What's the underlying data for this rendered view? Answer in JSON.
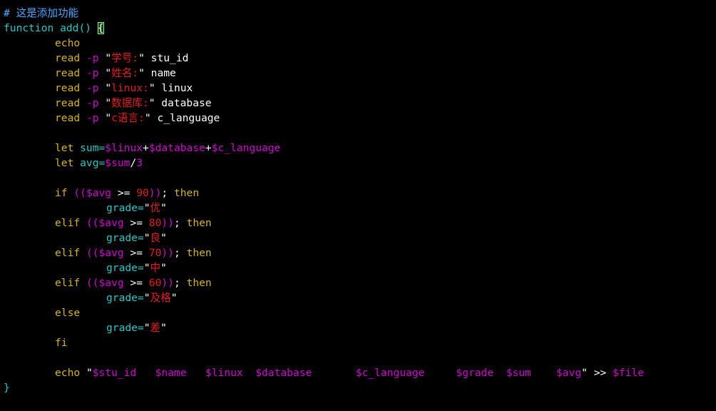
{
  "colors": {
    "background": "#000000",
    "plain": "#ffffff",
    "comment": "#4aa7ff",
    "keyword_cyan": "#27c7c7",
    "keyword": "#d7b600",
    "string": "#e31b1b",
    "variable": "#d000d0",
    "number": "#e31b1b",
    "cursor": "#7dff7d"
  },
  "lines": [
    [
      [
        "# 这是添加功能",
        "comment"
      ]
    ],
    [
      [
        "function",
        "keyword_cyan"
      ],
      [
        " add() ",
        "keyword_cyan"
      ],
      [
        "{",
        "cursor"
      ]
    ],
    [
      [
        "indent",
        "indent"
      ],
      [
        "echo",
        "keyword"
      ]
    ],
    [
      [
        "indent",
        "indent"
      ],
      [
        "read",
        "keyword"
      ],
      [
        " -p ",
        "variable"
      ],
      [
        "\"",
        "plain_str"
      ],
      [
        "学号:",
        "string"
      ],
      [
        "\"",
        "plain_str"
      ],
      [
        " stu_id",
        "plain"
      ]
    ],
    [
      [
        "indent",
        "indent"
      ],
      [
        "read",
        "keyword"
      ],
      [
        " -p ",
        "variable"
      ],
      [
        "\"",
        "plain_str"
      ],
      [
        "姓名:",
        "string"
      ],
      [
        "\"",
        "plain_str"
      ],
      [
        " name",
        "plain"
      ]
    ],
    [
      [
        "indent",
        "indent"
      ],
      [
        "read",
        "keyword"
      ],
      [
        " -p ",
        "variable"
      ],
      [
        "\"",
        "plain_str"
      ],
      [
        "linux:",
        "string"
      ],
      [
        "\"",
        "plain_str"
      ],
      [
        " linux",
        "plain"
      ]
    ],
    [
      [
        "indent",
        "indent"
      ],
      [
        "read",
        "keyword"
      ],
      [
        " -p ",
        "variable"
      ],
      [
        "\"",
        "plain_str"
      ],
      [
        "数据库:",
        "string"
      ],
      [
        "\"",
        "plain_str"
      ],
      [
        " database",
        "plain"
      ]
    ],
    [
      [
        "indent",
        "indent"
      ],
      [
        "read",
        "keyword"
      ],
      [
        " -p ",
        "variable"
      ],
      [
        "\"",
        "plain_str"
      ],
      [
        "c语言:",
        "string"
      ],
      [
        "\"",
        "plain_str"
      ],
      [
        " c_language",
        "plain"
      ]
    ],
    [],
    [
      [
        "indent",
        "indent"
      ],
      [
        "let",
        "keyword"
      ],
      [
        " sum=",
        "keyword_cyan"
      ],
      [
        "$linux",
        "variable"
      ],
      [
        "+",
        "plain"
      ],
      [
        "$database",
        "variable"
      ],
      [
        "+",
        "plain"
      ],
      [
        "$c_language",
        "variable"
      ]
    ],
    [
      [
        "indent",
        "indent"
      ],
      [
        "let",
        "keyword"
      ],
      [
        " avg=",
        "keyword_cyan"
      ],
      [
        "$sum",
        "variable"
      ],
      [
        "/",
        "plain"
      ],
      [
        "3",
        "variable"
      ]
    ],
    [],
    [
      [
        "indent",
        "indent"
      ],
      [
        "if",
        "keyword"
      ],
      [
        " ((",
        "variable"
      ],
      [
        "$avg",
        "variable"
      ],
      [
        " >= ",
        "plain"
      ],
      [
        "90",
        "number"
      ],
      [
        "))",
        "variable"
      ],
      [
        "; ",
        "plain"
      ],
      [
        "then",
        "keyword"
      ]
    ],
    [
      [
        "indent2",
        "indent2"
      ],
      [
        "grade=",
        "keyword_cyan"
      ],
      [
        "\"",
        "plain_str"
      ],
      [
        "优",
        "string"
      ],
      [
        "\"",
        "plain_str"
      ]
    ],
    [
      [
        "indent",
        "indent"
      ],
      [
        "elif",
        "keyword"
      ],
      [
        " ((",
        "variable"
      ],
      [
        "$avg",
        "variable"
      ],
      [
        " >= ",
        "plain"
      ],
      [
        "80",
        "number"
      ],
      [
        "))",
        "variable"
      ],
      [
        "; ",
        "plain"
      ],
      [
        "then",
        "keyword"
      ]
    ],
    [
      [
        "indent2",
        "indent2"
      ],
      [
        "grade=",
        "keyword_cyan"
      ],
      [
        "\"",
        "plain_str"
      ],
      [
        "良",
        "string"
      ],
      [
        "\"",
        "plain_str"
      ]
    ],
    [
      [
        "indent",
        "indent"
      ],
      [
        "elif",
        "keyword"
      ],
      [
        " ((",
        "variable"
      ],
      [
        "$avg",
        "variable"
      ],
      [
        " >= ",
        "plain"
      ],
      [
        "70",
        "number"
      ],
      [
        "))",
        "variable"
      ],
      [
        "; ",
        "plain"
      ],
      [
        "then",
        "keyword"
      ]
    ],
    [
      [
        "indent2",
        "indent2"
      ],
      [
        "grade=",
        "keyword_cyan"
      ],
      [
        "\"",
        "plain_str"
      ],
      [
        "中",
        "string"
      ],
      [
        "\"",
        "plain_str"
      ]
    ],
    [
      [
        "indent",
        "indent"
      ],
      [
        "elif",
        "keyword"
      ],
      [
        " ((",
        "variable"
      ],
      [
        "$avg",
        "variable"
      ],
      [
        " >= ",
        "plain"
      ],
      [
        "60",
        "number"
      ],
      [
        "))",
        "variable"
      ],
      [
        "; ",
        "plain"
      ],
      [
        "then",
        "keyword"
      ]
    ],
    [
      [
        "indent2",
        "indent2"
      ],
      [
        "grade=",
        "keyword_cyan"
      ],
      [
        "\"",
        "plain_str"
      ],
      [
        "及格",
        "string"
      ],
      [
        "\"",
        "plain_str"
      ]
    ],
    [
      [
        "indent",
        "indent"
      ],
      [
        "else",
        "keyword"
      ]
    ],
    [
      [
        "indent2",
        "indent2"
      ],
      [
        "grade=",
        "keyword_cyan"
      ],
      [
        "\"",
        "plain_str"
      ],
      [
        "差",
        "string"
      ],
      [
        "\"",
        "plain_str"
      ]
    ],
    [
      [
        "indent",
        "indent"
      ],
      [
        "fi",
        "keyword"
      ]
    ],
    [],
    [
      [
        "indent",
        "indent"
      ],
      [
        "echo",
        "keyword"
      ],
      [
        " ",
        "plain"
      ],
      [
        "\"",
        "plain_str"
      ],
      [
        "$stu_id",
        "variable"
      ],
      [
        "   ",
        "plain"
      ],
      [
        "$name",
        "variable"
      ],
      [
        "   ",
        "plain"
      ],
      [
        "$linux",
        "variable"
      ],
      [
        "  ",
        "plain"
      ],
      [
        "$database",
        "variable"
      ],
      [
        "       ",
        "plain"
      ],
      [
        "$c_language",
        "variable"
      ],
      [
        "     ",
        "plain"
      ],
      [
        "$grade",
        "variable"
      ],
      [
        "  ",
        "plain"
      ],
      [
        "$sum",
        "variable"
      ],
      [
        "    ",
        "plain"
      ],
      [
        "$avg",
        "variable"
      ],
      [
        "\"",
        "plain_str"
      ],
      [
        " >> ",
        "plain"
      ],
      [
        "$file",
        "variable"
      ]
    ],
    [
      [
        "}",
        "keyword_cyan"
      ]
    ]
  ]
}
